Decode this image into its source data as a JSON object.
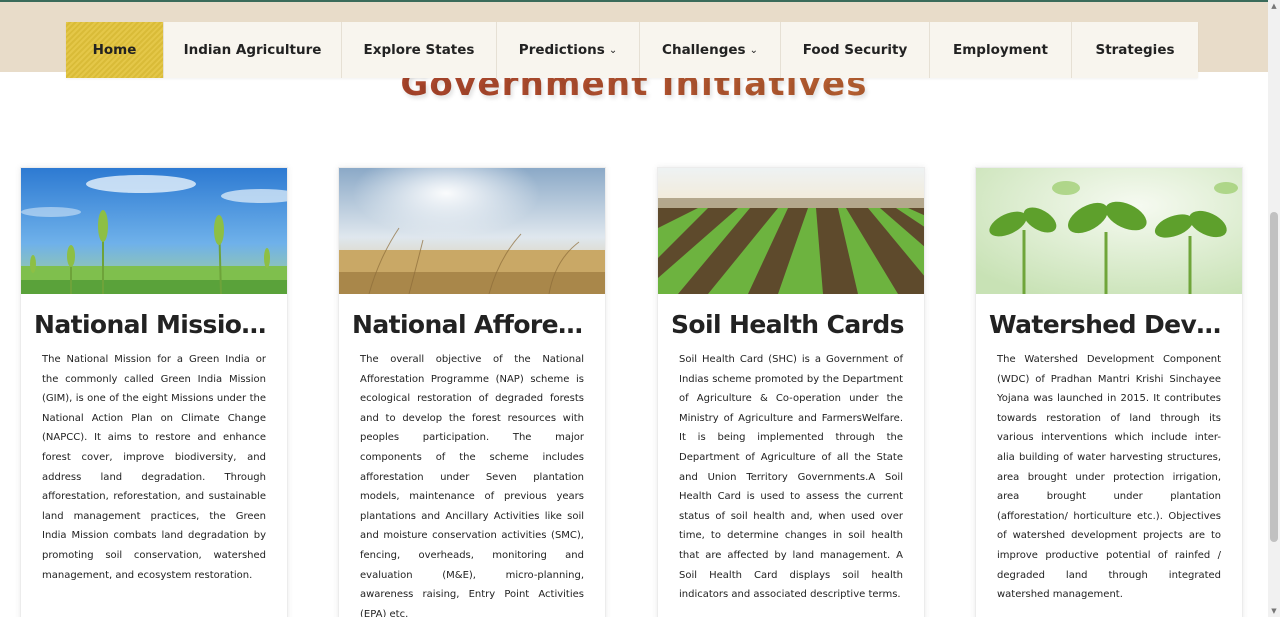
{
  "nav": {
    "items": [
      {
        "label": "Home",
        "active": true
      },
      {
        "label": "Indian Agriculture"
      },
      {
        "label": "Explore States"
      },
      {
        "label": "Predictions",
        "dropdown": true
      },
      {
        "label": "Challenges",
        "dropdown": true
      },
      {
        "label": "Food Security"
      },
      {
        "label": "Employment"
      },
      {
        "label": "Strategies"
      }
    ]
  },
  "page": {
    "title": "Government Initiatives"
  },
  "cards": [
    {
      "title": "National Mission for a Green India",
      "text": "The National Mission for a Green India or the commonly called Green India Mission (GIM), is one of the eight Missions under the National Action Plan on Climate Change (NAPCC). It aims to restore and enhance forest cover, improve biodiversity, and address land degradation. Through afforestation, reforestation, and sustainable land management practices, the Green India Mission combats land degradation by promoting soil conservation, watershed management, and ecosystem restoration."
    },
    {
      "title": "National Afforestation Programme",
      "text": "The overall objective of the National Afforestation Programme (NAP) scheme is ecological restoration of degraded forests and to develop the forest resources with peoples participation. The major components of the scheme includes afforestation under Seven plantation models, maintenance of previous years plantations and Ancillary Activities like soil and moisture conservation activities (SMC), fencing, overheads, monitoring and evaluation (M&E), micro-planning, awareness raising, Entry Point Activities (EPA) etc."
    },
    {
      "title": "Soil Health Cards",
      "text": "Soil Health Card (SHC) is a Government of Indias scheme promoted by the Department of Agriculture & Co-operation under the Ministry of Agriculture and FarmersWelfare. It is being implemented through the Department of Agriculture of all the State and Union Territory Governments.A Soil Health Card is used to assess the current status of soil health and, when used over time, to determine changes in soil health that are affected by land management. A Soil Health Card displays soil health indicators and associated descriptive terms."
    },
    {
      "title": "Watershed Development",
      "text": "The Watershed Development Component (WDC) of Pradhan Mantri Krishi Sinchayee Yojana was launched in 2015. It contributes towards restoration of land through its various interventions which include inter-alia building of water harvesting structures, area brought under protection irrigation, area brought under plantation (afforestation/ horticulture etc.). Objectives of watershed development projects are to improve productive potential of rainfed / degraded land through integrated watershed management."
    }
  ],
  "colors": {
    "nav_active": "#e2c33a",
    "topbar": "#e8dcc9",
    "title_start": "#9e2f23",
    "title_end": "#c47a35"
  },
  "icons": {
    "chevron": "chevron-down-icon"
  }
}
